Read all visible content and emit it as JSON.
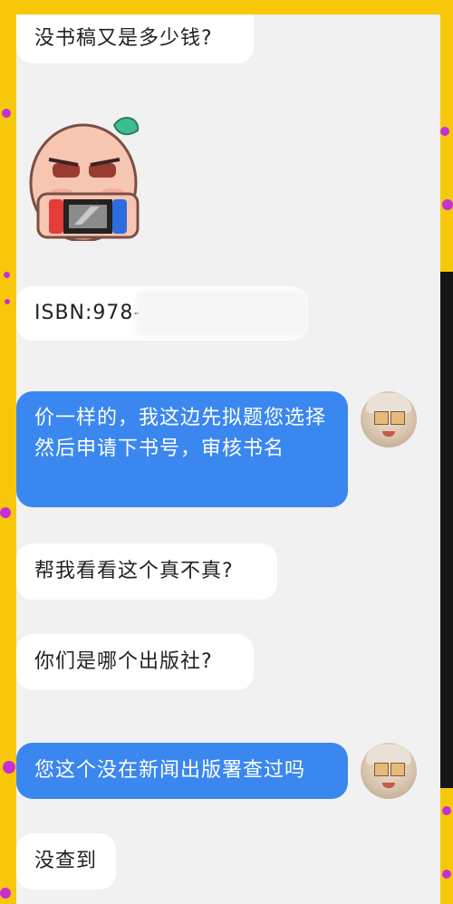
{
  "messages": [
    {
      "text": "没书稿又是多少钱?",
      "side": "left"
    },
    {
      "text": "ISBN:978-",
      "side": "left"
    },
    {
      "text": "价一样的，我这边先拟题您选择 然后申请下书号，审核书名",
      "side": "right"
    },
    {
      "text": "帮我看看这个真不真?",
      "side": "left"
    },
    {
      "text": "你们是哪个出版社?",
      "side": "left"
    },
    {
      "text": "您这个没在新闻出版署查过吗",
      "side": "right"
    },
    {
      "text": "没查到",
      "side": "left"
    }
  ],
  "sticker": {
    "icon": "gaming-character-sticker-icon"
  },
  "avatar": {
    "icon": "user-avatar-icon"
  }
}
